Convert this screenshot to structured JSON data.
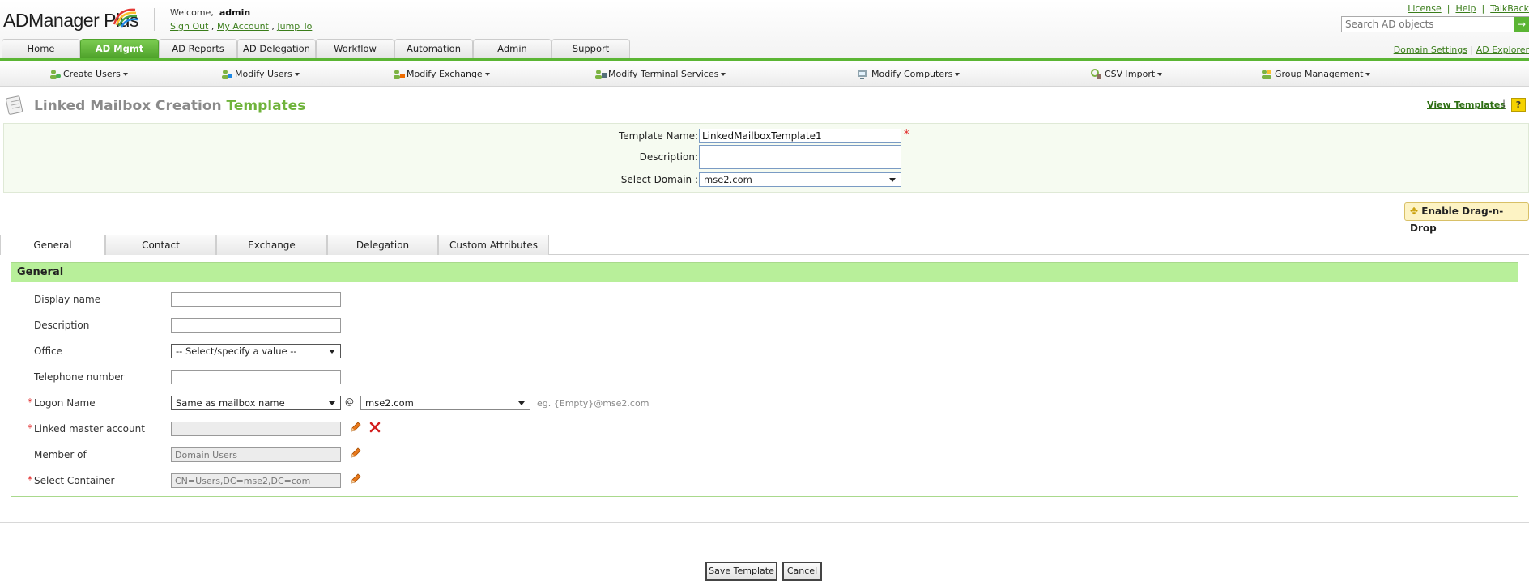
{
  "header": {
    "logo": "ADManager Plus",
    "welcome": "Welcome,",
    "user": "admin",
    "links": [
      "Sign Out",
      "My Account",
      "Jump To"
    ],
    "right_links": [
      "License",
      "Help",
      "TalkBack"
    ],
    "search_placeholder": "Search AD objects",
    "search_go": "→"
  },
  "tabs": [
    "Home",
    "AD Mgmt",
    "AD Reports",
    "AD Delegation",
    "Workflow",
    "Automation",
    "Admin",
    "Support"
  ],
  "active_tab": "AD Mgmt",
  "sub_links": [
    "Domain Settings",
    "AD Explorer"
  ],
  "submenu": [
    "Create Users",
    "Modify Users",
    "Modify Exchange",
    "Modify Terminal Services",
    "Modify Computers",
    "CSV Import",
    "Group Management"
  ],
  "page": {
    "title_main": "Linked Mailbox Creation",
    "title_hl": "Templates",
    "view_templates": "View Templates",
    "help": "?"
  },
  "template": {
    "name_label": "Template Name:",
    "name_value": "LinkedMailboxTemplate1",
    "desc_label": "Description:",
    "desc_value": "",
    "domain_label": "Select Domain :",
    "domain_value": "mse2.com",
    "required_mark": "*"
  },
  "drag_button": "Enable Drag-n-Drop",
  "form_tabs": [
    "General",
    "Contact",
    "Exchange",
    "Delegation",
    "Custom Attributes"
  ],
  "section": {
    "title": "General",
    "fields": {
      "display_name": {
        "label": "Display name",
        "value": ""
      },
      "description": {
        "label": "Description",
        "value": ""
      },
      "office": {
        "label": "Office",
        "value": "-- Select/specify a value --"
      },
      "telephone": {
        "label": "Telephone number",
        "value": ""
      },
      "logon": {
        "label": "Logon Name",
        "value": "Same as mailbox name",
        "at": "@",
        "domain": "mse2.com",
        "hint": "eg.  {Empty}@mse2.com"
      },
      "linked_master": {
        "label": "Linked master account",
        "value": ""
      },
      "member_of": {
        "label": "Member of",
        "value": "Domain Users"
      },
      "container": {
        "label": "Select Container",
        "value": "CN=Users,DC=mse2,DC=com"
      }
    }
  },
  "buttons": {
    "save": "Save Template",
    "cancel": "Cancel"
  },
  "colors": {
    "brand_green": "#5bb534",
    "section_header": "#b8ef9a",
    "required": "#e02020"
  }
}
